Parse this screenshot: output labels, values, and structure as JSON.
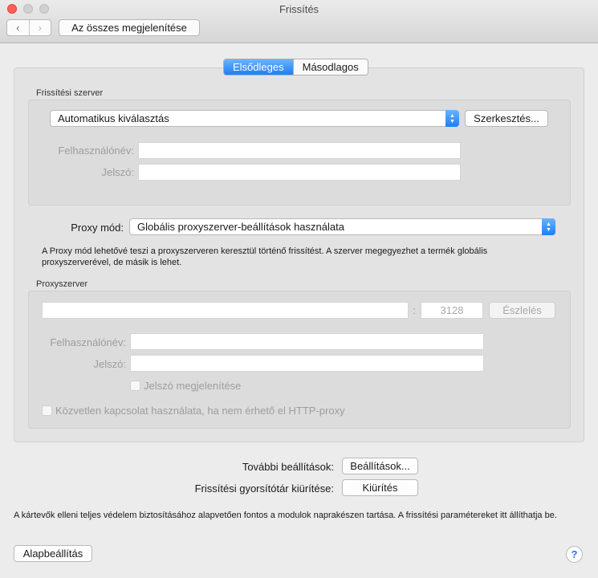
{
  "window": {
    "title": "Frissítés",
    "show_all_label": "Az összes megjelenítése",
    "nav_back_glyph": "‹",
    "nav_forward_glyph": "›"
  },
  "tabs": [
    {
      "label": "Elsődleges",
      "active": true
    },
    {
      "label": "Másodlagos",
      "active": false
    }
  ],
  "update_server": {
    "group_label": "Frissítési szerver",
    "server_value": "Automatikus kiválasztás",
    "edit_button": "Szerkesztés...",
    "username_label": "Felhasználónév:",
    "username_value": "",
    "password_label": "Jelszó:",
    "password_value": ""
  },
  "proxy_mode": {
    "label": "Proxy mód:",
    "value": "Globális proxyszerver-beállítások használata",
    "description": "A Proxy mód lehetővé teszi a proxyszerveren keresztül történő frissítést. A szerver megegyezhet a termék globális proxyszerverével, de másik is lehet."
  },
  "proxy_server": {
    "group_label": "Proxyszerver",
    "host_value": "",
    "port_separator": ":",
    "port_value": "3128",
    "detect_button": "Észlelés",
    "username_label": "Felhasználónév:",
    "username_value": "",
    "password_label": "Jelszó:",
    "password_value": "",
    "show_password_label": "Jelszó megjelenítése",
    "direct_connection_label": "Közvetlen kapcsolat használata, ha nem érhető el HTTP-proxy"
  },
  "more_settings": {
    "label": "További beállítások:",
    "button": "Beállítások..."
  },
  "clear_cache": {
    "label": "Frissítési gyorsítótár kiürítése:",
    "button": "Kiürítés"
  },
  "footer": {
    "description": "A kártevők elleni teljes védelem biztosításához alapvetően fontos a modulok naprakészen tartása. A frissítési paramétereket itt állíthatja be.",
    "default_button": "Alapbeállítás",
    "help_glyph": "?"
  },
  "colors": {
    "accent": "#1c7ef6",
    "close": "#fc5f57"
  }
}
